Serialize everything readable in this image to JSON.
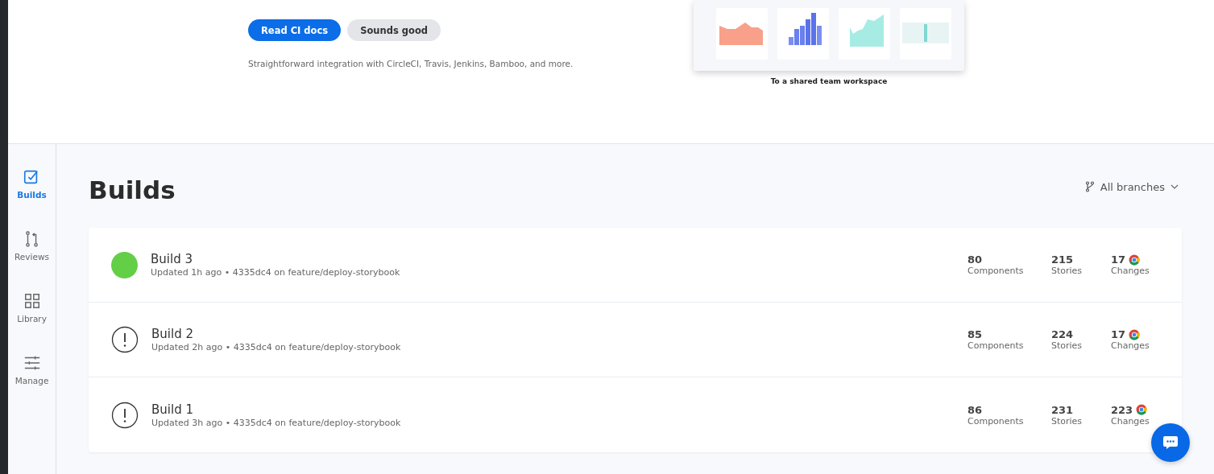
{
  "promo": {
    "buttons": [
      {
        "label": "Read CI docs",
        "kind": "primary"
      },
      {
        "label": "Sounds good",
        "kind": "secondary"
      }
    ],
    "note": "Straightforward integration with CircleCI, Travis, Jenkins, Bamboo, and more.",
    "preview_caption": "To a shared team workspace"
  },
  "sidebar": {
    "items": [
      {
        "label": "Builds",
        "selected": true
      },
      {
        "label": "Reviews",
        "selected": false
      },
      {
        "label": "Library",
        "selected": false
      },
      {
        "label": "Manage",
        "selected": false
      }
    ]
  },
  "page": {
    "title": "Builds",
    "branch_filter": "All branches"
  },
  "builds": [
    {
      "name": "Build 3",
      "kind": "passed",
      "meta": "Updated 1h ago • 4335dc4 on feature/deploy-storybook",
      "components": "80",
      "components_label": "Components",
      "stories": "215",
      "stories_label": "Stories",
      "changes": "17",
      "changes_label": "Changes"
    },
    {
      "name": "Build 2",
      "kind": "warning",
      "meta": "Updated 2h ago • 4335dc4 on feature/deploy-storybook",
      "components": "85",
      "components_label": "Components",
      "stories": "224",
      "stories_label": "Stories",
      "changes": "17",
      "changes_label": "Changes"
    },
    {
      "name": "Build 1",
      "kind": "warning",
      "meta": "Updated 3h ago • 4335dc4 on feature/deploy-storybook",
      "components": "86",
      "components_label": "Components",
      "stories": "231",
      "stories_label": "Stories",
      "changes": "223",
      "changes_label": "Changes"
    }
  ]
}
